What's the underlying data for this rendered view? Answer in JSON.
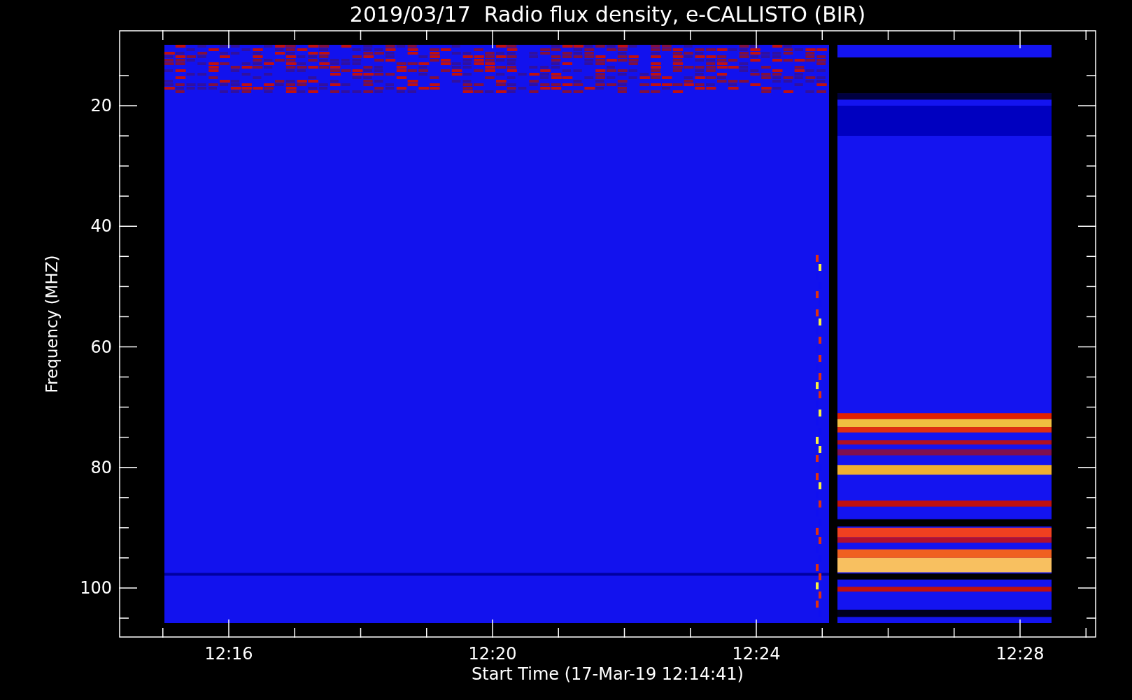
{
  "title": "2019/03/17  Radio flux density, e-CALLISTO (BIR)",
  "y_axis": {
    "label": "Frequency (MHZ)",
    "ticks": [
      "20",
      "40",
      "60",
      "80",
      "100"
    ]
  },
  "x_axis": {
    "label": "Start Time (17-Mar-19 12:14:41)",
    "ticks": [
      "12:16",
      "12:20",
      "12:24",
      "12:28"
    ]
  }
}
